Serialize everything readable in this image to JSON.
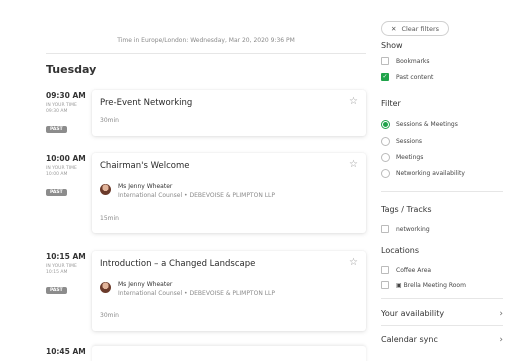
{
  "timezone_text": "Time in Europe/London: Wednesday, Mar 20, 2020 9:36 PM",
  "day_label": "Tuesday",
  "sessions": [
    {
      "time": "09:30 AM",
      "your_time_label": "IN YOUR TIME",
      "your_time": "09:30 AM",
      "badge": "PAST",
      "title": "Pre-Event Networking",
      "duration": "30min"
    },
    {
      "time": "10:00 AM",
      "your_time_label": "IN YOUR TIME",
      "your_time": "10:00 AM",
      "badge": "PAST",
      "title": "Chairman's Welcome",
      "speaker_name": "Ms Jenny Wheater",
      "speaker_role": "International Counsel • DEBEVOISE & PLIMPTON LLP",
      "duration": "15min"
    },
    {
      "time": "10:15 AM",
      "your_time_label": "IN YOUR TIME",
      "your_time": "10:15 AM",
      "badge": "PAST",
      "title": "Introduction – a Changed Landscape",
      "speaker_name": "Ms Jenny Wheater",
      "speaker_role": "International Counsel • DEBEVOISE & PLIMPTON LLP",
      "duration": "30min"
    }
  ],
  "next_time": "10:45 AM",
  "sidebar": {
    "clear_filters": "Clear filters",
    "show_title": "Show",
    "show_options": [
      {
        "label": "Bookmarks",
        "checked": false
      },
      {
        "label": "Past content",
        "checked": true
      }
    ],
    "filter_title": "Filter",
    "filter_options": [
      {
        "label": "Sessions & Meetings",
        "selected": true
      },
      {
        "label": "Sessions",
        "selected": false
      },
      {
        "label": "Meetings",
        "selected": false
      },
      {
        "label": "Networking availability",
        "selected": false
      }
    ],
    "tags_title": "Tags / Tracks",
    "tags": [
      {
        "label": "networking"
      }
    ],
    "locations_title": "Locations",
    "locations": [
      {
        "label": "Coffee Area"
      },
      {
        "label": "Brella Meeting Room"
      }
    ],
    "availability_label": "Your availability",
    "calendar_label": "Calendar sync"
  },
  "colors": {
    "accent": "#1fa34a",
    "past_badge": "#8c8c8c"
  }
}
